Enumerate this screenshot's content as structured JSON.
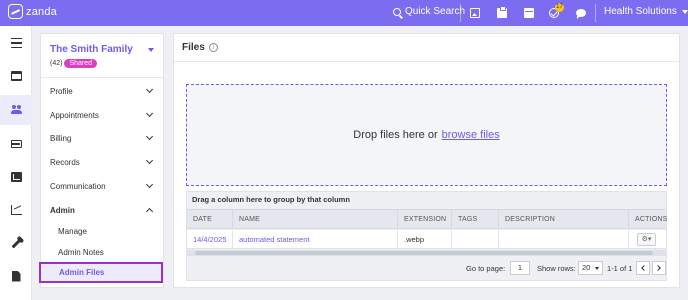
{
  "app": {
    "logo_text": "zanda"
  },
  "topbar": {
    "search_label": "Quick Search",
    "notification_count": "17",
    "org_name": "Health Solutions",
    "icons": [
      "image-icon",
      "clipboard-icon",
      "calendar-icon",
      "check-icon",
      "chat-icon"
    ]
  },
  "rail": {
    "items": [
      "menu-icon",
      "calendar-icon",
      "people-icon",
      "card-icon",
      "billing-icon",
      "chart-icon",
      "wrench-icon",
      "document-icon"
    ],
    "active": "people-icon"
  },
  "client": {
    "name": "The Smith Family",
    "count": "(42)",
    "badge": "Shared"
  },
  "nav": {
    "items": [
      {
        "label": "Profile"
      },
      {
        "label": "Appointments"
      },
      {
        "label": "Billing"
      },
      {
        "label": "Records"
      },
      {
        "label": "Communication"
      },
      {
        "label": "Admin"
      }
    ],
    "admin_sub": [
      {
        "label": "Manage"
      },
      {
        "label": "Admin Notes"
      },
      {
        "label": "Admin Files"
      }
    ]
  },
  "files": {
    "title": "Files",
    "dropzone_text": "Drop files here or",
    "dropzone_link": "browse files",
    "group_hint": "Drag a column here to group by that column",
    "columns": [
      "DATE",
      "NAME",
      "EXTENSION",
      "TAGS",
      "DESCRIPTION",
      "ACTIONS"
    ],
    "rows": [
      {
        "date": "14/4/2025",
        "name": "automated statement",
        "extension": ".webp",
        "tags": "",
        "description": ""
      }
    ],
    "pager": {
      "go_to_label": "Go to page:",
      "page": "1",
      "rows_label": "Show rows:",
      "rows": "20",
      "range": "1-1 of 1"
    }
  },
  "colors": {
    "accent": "#7b6cf0",
    "badge": "#d93fbf",
    "highlight": "#9b30c8"
  }
}
